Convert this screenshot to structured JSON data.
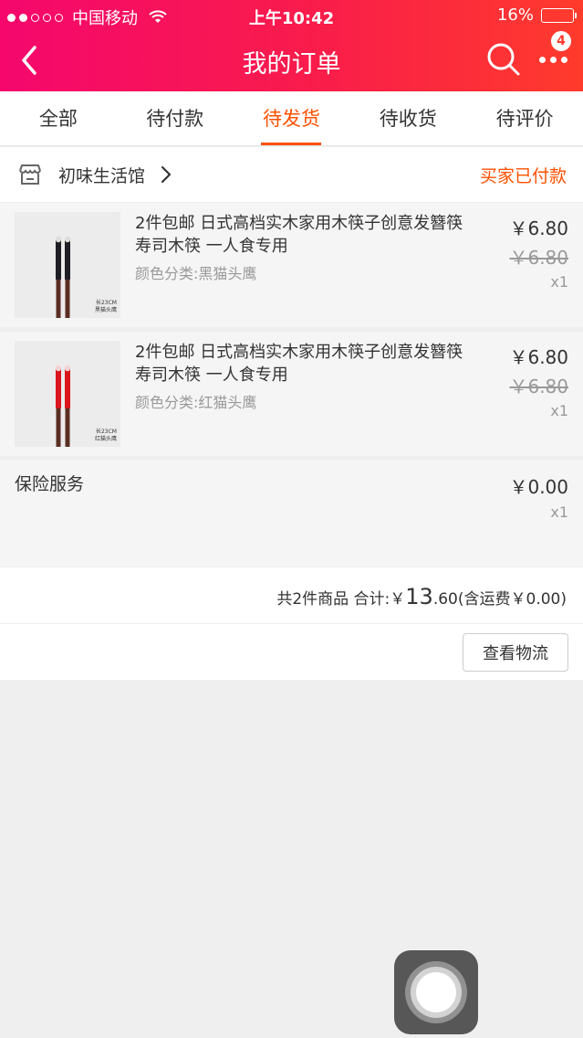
{
  "status_bar": {
    "carrier": "中国移动",
    "time": "上午10:42",
    "battery": "16%",
    "battery_level": 0.16
  },
  "nav": {
    "title": "我的订单",
    "badge": "4"
  },
  "tabs": [
    {
      "label": "全部",
      "active": false
    },
    {
      "label": "待付款",
      "active": false
    },
    {
      "label": "待发货",
      "active": true
    },
    {
      "label": "待收货",
      "active": false
    },
    {
      "label": "待评价",
      "active": false
    }
  ],
  "shop": {
    "name": "初味生活馆",
    "status": "买家已付款"
  },
  "items": [
    {
      "title": "2件包邮 日式高档实木家用木筷子创意发簪筷寿司木筷 一人食专用",
      "sku": "颜色分类:黑猫头鹰",
      "price": "￥6.80",
      "original_price": "￥6.80",
      "qty": "x1",
      "img_caption_1": "长23CM",
      "img_caption_2": "黑猫头鹰",
      "color": "#1e1e24"
    },
    {
      "title": "2件包邮 日式高档实木家用木筷子创意发簪筷寿司木筷 一人食专用",
      "sku": "颜色分类:红猫头鹰",
      "price": "￥6.80",
      "original_price": "￥6.80",
      "qty": "x1",
      "img_caption_1": "长23CM",
      "img_caption_2": "红猫头鹰",
      "color": "#d8161b"
    }
  ],
  "service": {
    "label": "保险服务",
    "price": "￥0.00",
    "qty": "x1"
  },
  "summary": {
    "count_text": "共2件商品 合计:",
    "currency": "￥",
    "total_big": "13",
    "total_small": ".60",
    "shipping": " (含运费￥0.00)"
  },
  "actions": {
    "logistics": "查看物流"
  },
  "colors": {
    "accent": "#ff5000",
    "header_start": "#f5076d",
    "header_end": "#ff3b2c"
  }
}
